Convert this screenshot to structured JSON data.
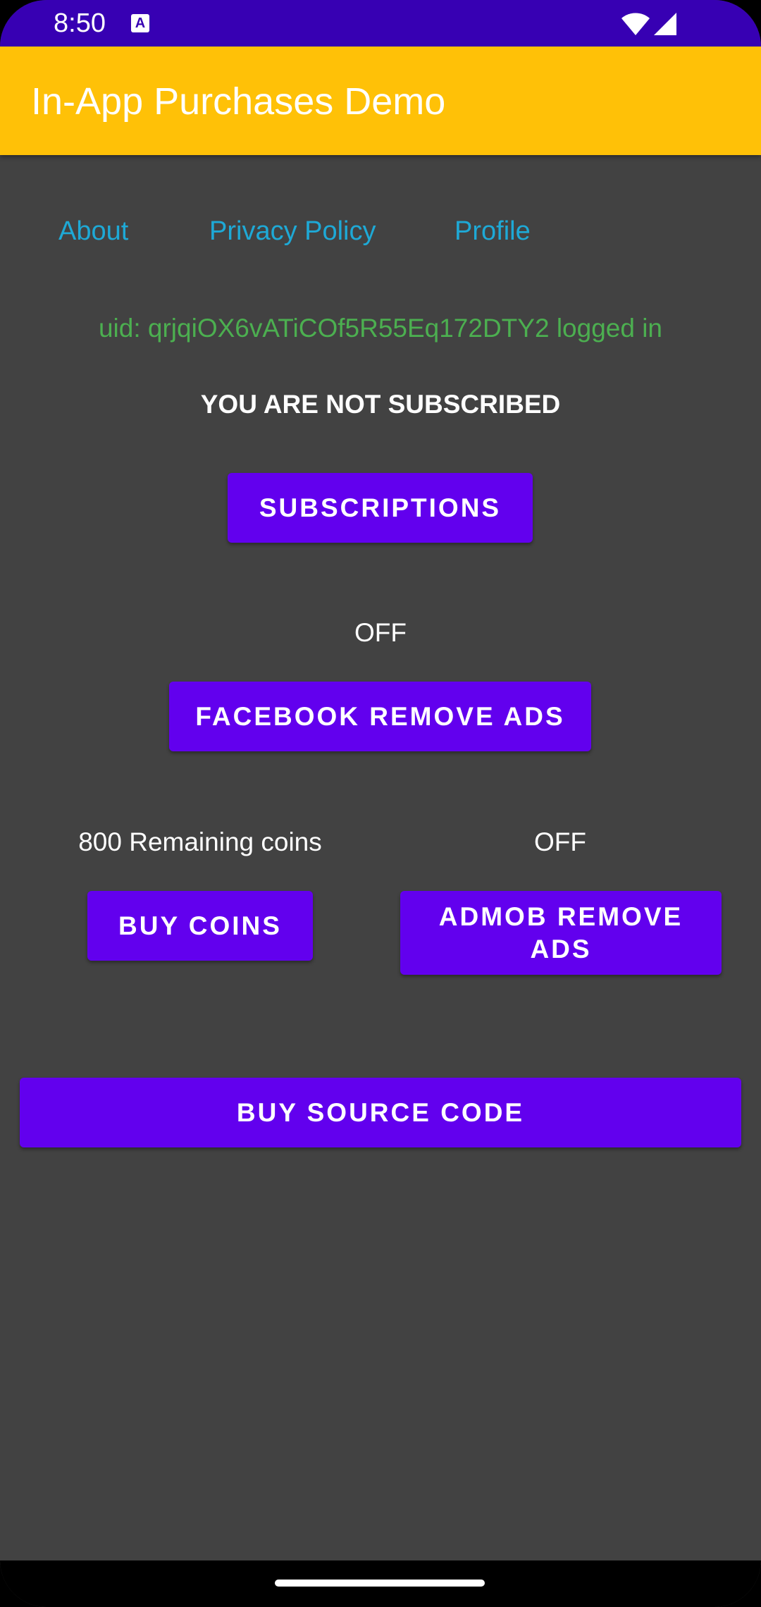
{
  "status_bar": {
    "time": "8:50",
    "notification_icon": "a-icon",
    "icons": [
      "wifi-icon",
      "signal-icon"
    ]
  },
  "app_bar": {
    "title": "In-App Purchases Demo",
    "color": "#FFC107"
  },
  "links": {
    "about": "About",
    "privacy_policy": "Privacy Policy",
    "profile": "Profile"
  },
  "user": {
    "uid_status": "uid: qrjqiOX6vATiCOf5R55Eq172DTY2 logged in"
  },
  "subscription": {
    "status": "YOU ARE NOT SUBSCRIBED",
    "button_label": "SUBSCRIPTIONS"
  },
  "facebook_ads": {
    "status": "OFF",
    "button_label": "FACEBOOK REMOVE ADS"
  },
  "coins": {
    "remaining": "800 Remaining coins",
    "button_label": "BUY COINS"
  },
  "admob_ads": {
    "status": "OFF",
    "button_label": "ADMOB REMOVE ADS"
  },
  "source_code": {
    "button_label": "BUY SOURCE CODE"
  },
  "colors": {
    "status_bar": "#3700B3",
    "background": "#424242",
    "button": "#6200EE",
    "link": "#1EA9D6",
    "uid_text": "#4CAF50"
  }
}
